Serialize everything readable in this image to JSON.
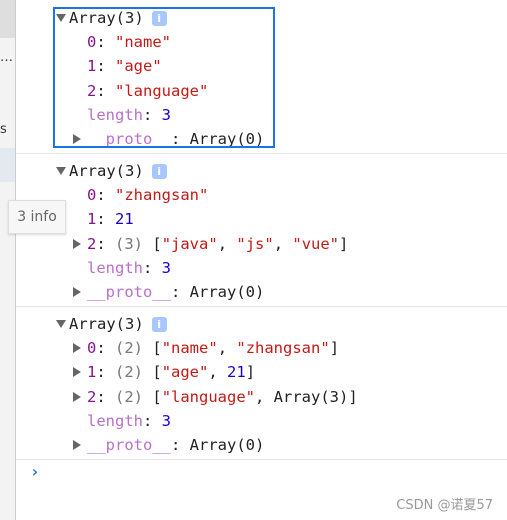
{
  "sidebar": {
    "items": [
      "…",
      "s"
    ]
  },
  "tooltip": "3 info",
  "groups": [
    {
      "header": "Array(3)",
      "lines": [
        {
          "expand": false,
          "key": "0",
          "parts": [
            {
              "t": "\"name\"",
              "c": "s"
            }
          ]
        },
        {
          "expand": false,
          "key": "1",
          "parts": [
            {
              "t": "\"age\"",
              "c": "s"
            }
          ]
        },
        {
          "expand": false,
          "key": "2",
          "parts": [
            {
              "t": "\"language\"",
              "c": "s"
            }
          ]
        },
        {
          "expand": false,
          "key": "length",
          "meta": true,
          "parts": [
            {
              "t": "3",
              "c": "n"
            }
          ]
        },
        {
          "expand": true,
          "key": "__proto__",
          "meta": true,
          "parts": [
            {
              "t": "Array(0)",
              "c": ""
            }
          ]
        }
      ]
    },
    {
      "header": "Array(3)",
      "lines": [
        {
          "expand": false,
          "key": "0",
          "parts": [
            {
              "t": "\"zhangsan\"",
              "c": "s"
            }
          ]
        },
        {
          "expand": false,
          "key": "1",
          "parts": [
            {
              "t": "21",
              "c": "n"
            }
          ]
        },
        {
          "expand": true,
          "key": "2",
          "parts": [
            {
              "t": "(3) ",
              "c": "g"
            },
            {
              "t": "[",
              "c": ""
            },
            {
              "t": "\"java\"",
              "c": "s"
            },
            {
              "t": ", ",
              "c": ""
            },
            {
              "t": "\"js\"",
              "c": "s"
            },
            {
              "t": ", ",
              "c": ""
            },
            {
              "t": "\"vue\"",
              "c": "s"
            },
            {
              "t": "]",
              "c": ""
            }
          ]
        },
        {
          "expand": false,
          "key": "length",
          "meta": true,
          "parts": [
            {
              "t": "3",
              "c": "n"
            }
          ]
        },
        {
          "expand": true,
          "key": "__proto__",
          "meta": true,
          "parts": [
            {
              "t": "Array(0)",
              "c": ""
            }
          ]
        }
      ]
    },
    {
      "header": "Array(3)",
      "lines": [
        {
          "expand": true,
          "key": "0",
          "parts": [
            {
              "t": "(2) ",
              "c": "g"
            },
            {
              "t": "[",
              "c": ""
            },
            {
              "t": "\"name\"",
              "c": "s"
            },
            {
              "t": ", ",
              "c": ""
            },
            {
              "t": "\"zhangsan\"",
              "c": "s"
            },
            {
              "t": "]",
              "c": ""
            }
          ]
        },
        {
          "expand": true,
          "key": "1",
          "parts": [
            {
              "t": "(2) ",
              "c": "g"
            },
            {
              "t": "[",
              "c": ""
            },
            {
              "t": "\"age\"",
              "c": "s"
            },
            {
              "t": ", ",
              "c": ""
            },
            {
              "t": "21",
              "c": "n"
            },
            {
              "t": "]",
              "c": ""
            }
          ]
        },
        {
          "expand": true,
          "key": "2",
          "parts": [
            {
              "t": "(2) ",
              "c": "g"
            },
            {
              "t": "[",
              "c": ""
            },
            {
              "t": "\"language\"",
              "c": "s"
            },
            {
              "t": ", Array(3)]",
              "c": ""
            }
          ]
        },
        {
          "expand": false,
          "key": "length",
          "meta": true,
          "parts": [
            {
              "t": "3",
              "c": "n"
            }
          ]
        },
        {
          "expand": true,
          "key": "__proto__",
          "meta": true,
          "parts": [
            {
              "t": "Array(0)",
              "c": ""
            }
          ]
        }
      ]
    }
  ],
  "prompt": "›",
  "watermark": "CSDN @诺夏57",
  "colors": {
    "highlight_box": "#1a73e8",
    "key": "#881391",
    "string": "#c41a16",
    "number": "#1c00cf"
  }
}
